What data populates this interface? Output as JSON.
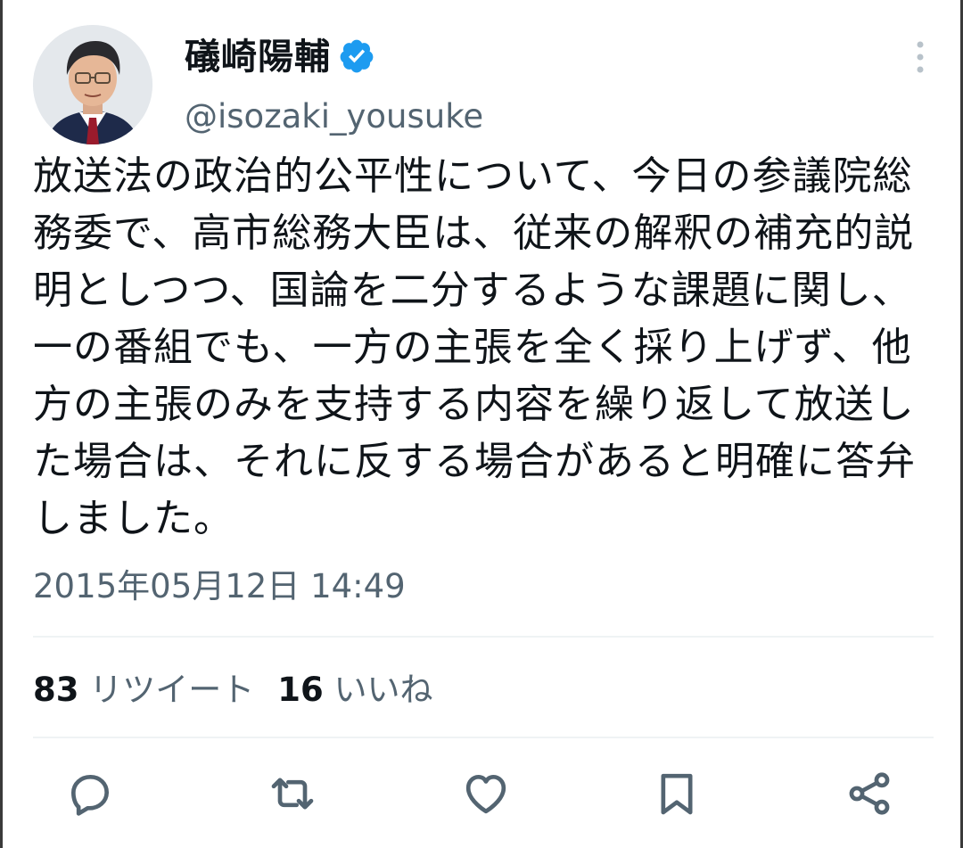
{
  "tweet": {
    "display_name": "礒崎陽輔",
    "handle": "@isozaki_yousuke",
    "verified_icon": "verified-badge-icon",
    "text": "放送法の政治的公平性について、今日の参議院総務委で、高市総務大臣は、従来の解釈の補充的説明としつつ、国論を二分するような課題に関し、一の番組でも、一方の主張を全く採り上げず、他方の主張のみを支持する内容を繰り返して放送した場合は、それに反する場合があると明確に答弁しました。",
    "timestamp": "2015年05月12日 14:49"
  },
  "stats": {
    "retweets_count": "83",
    "retweets_label": "リツイート",
    "likes_count": "16",
    "likes_label": "いいね"
  },
  "actions": {
    "reply_icon": "reply-icon",
    "retweet_icon": "retweet-icon",
    "like_icon": "heart-icon",
    "bookmark_icon": "bookmark-icon",
    "share_icon": "share-icon"
  },
  "colors": {
    "text_primary": "#0f1419",
    "text_secondary": "#536471",
    "verified_blue": "#1d9bf0",
    "divider": "#eff3f4"
  }
}
